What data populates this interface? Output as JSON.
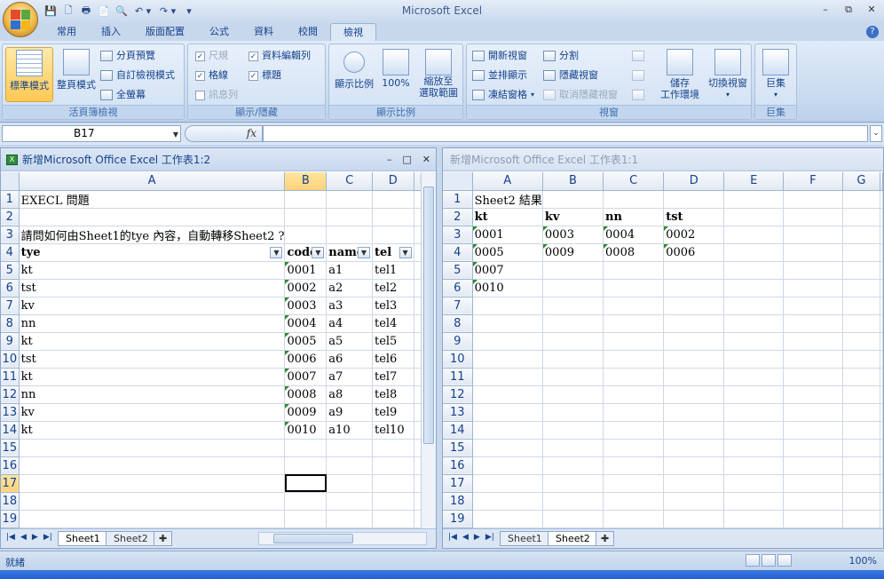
{
  "window": {
    "title": "Microsoft Excel",
    "controls": [
      "–",
      "⧉",
      "✕"
    ]
  },
  "qat": {
    "icons": [
      "💾",
      "🗋",
      "🖶",
      "📄",
      "🔍",
      "↶ ▾",
      "↷ ▾",
      "▾"
    ]
  },
  "tabs": [
    "常用",
    "插入",
    "版面配置",
    "公式",
    "資料",
    "校閱",
    "檢視"
  ],
  "active_tab": "檢視",
  "ribbon": {
    "workbook_views": {
      "label": "活頁簿檢視",
      "normal": "標準模式",
      "page_layout": "整頁模式",
      "page_break": "分頁預覽",
      "custom_views": "自訂檢視模式",
      "full_screen": "全螢幕"
    },
    "show_hide": {
      "label": "顯示/隱藏",
      "ruler": "尺規",
      "formula_bar": "資料編輯列",
      "gridlines": "格線",
      "headings": "標題",
      "message_bar": "訊息列"
    },
    "zoom": {
      "label": "顯示比例",
      "zoom": "顯示比例",
      "hundred": "100%",
      "zoom_to_sel_1": "縮放至",
      "zoom_to_sel_2": "選取範圍"
    },
    "window": {
      "label": "視窗",
      "new_window": "開新視窗",
      "arrange_all": "並排顯示",
      "freeze_panes": "凍結窗格",
      "split": "分割",
      "hide": "隱藏視窗",
      "unhide": "取消隱藏視窗",
      "save_workspace_1": "儲存",
      "save_workspace_2": "工作環境",
      "switch_windows": "切換視窗"
    },
    "macros": {
      "label": "巨集",
      "macros": "巨集"
    }
  },
  "formula_bar": {
    "name_box": "B17",
    "fx": "fx",
    "value": ""
  },
  "workbook1": {
    "title": "新增Microsoft Office Excel 工作表1:2",
    "columns": [
      "A",
      "B",
      "C",
      "D",
      "E"
    ],
    "selected_col": "B",
    "selected_row": "17",
    "rows": [
      {
        "n": "1",
        "cells": [
          "EXECL 問題",
          "",
          "",
          "",
          ""
        ]
      },
      {
        "n": "2",
        "cells": [
          "",
          "",
          "",
          "",
          ""
        ]
      },
      {
        "n": "3",
        "cells": [
          "請問如何由Sheet1的tye 內容，自動轉移Sheet2 ?",
          "",
          "",
          "",
          ""
        ]
      },
      {
        "n": "4",
        "cells": [
          "tye",
          "code",
          "name",
          "tel",
          ""
        ]
      },
      {
        "n": "5",
        "cells": [
          "kt",
          "0001",
          "a1",
          "tel1",
          ""
        ]
      },
      {
        "n": "6",
        "cells": [
          "tst",
          "0002",
          "a2",
          "tel2",
          ""
        ]
      },
      {
        "n": "7",
        "cells": [
          "kv",
          "0003",
          "a3",
          "tel3",
          ""
        ]
      },
      {
        "n": "8",
        "cells": [
          "nn",
          "0004",
          "a4",
          "tel4",
          ""
        ]
      },
      {
        "n": "9",
        "cells": [
          "kt",
          "0005",
          "a5",
          "tel5",
          ""
        ]
      },
      {
        "n": "10",
        "cells": [
          "tst",
          "0006",
          "a6",
          "tel6",
          ""
        ]
      },
      {
        "n": "11",
        "cells": [
          "kt",
          "0007",
          "a7",
          "tel7",
          ""
        ]
      },
      {
        "n": "12",
        "cells": [
          "nn",
          "0008",
          "a8",
          "tel8",
          ""
        ]
      },
      {
        "n": "13",
        "cells": [
          "kv",
          "0009",
          "a9",
          "tel9",
          ""
        ]
      },
      {
        "n": "14",
        "cells": [
          "kt",
          "0010",
          "a10",
          "tel10",
          ""
        ]
      },
      {
        "n": "15",
        "cells": [
          "",
          "",
          "",
          "",
          ""
        ]
      },
      {
        "n": "16",
        "cells": [
          "",
          "",
          "",
          "",
          ""
        ]
      },
      {
        "n": "17",
        "cells": [
          "",
          "",
          "",
          "",
          ""
        ]
      },
      {
        "n": "18",
        "cells": [
          "",
          "",
          "",
          "",
          ""
        ]
      },
      {
        "n": "19",
        "cells": [
          "",
          "",
          "",
          "",
          ""
        ]
      }
    ],
    "sheet_tabs": [
      "Sheet1",
      "Sheet2"
    ],
    "active_sheet": "Sheet1"
  },
  "workbook2": {
    "title": "新增Microsoft Office Excel 工作表1:1",
    "columns": [
      "A",
      "B",
      "C",
      "D",
      "E",
      "F",
      "G"
    ],
    "rows": [
      {
        "n": "1",
        "cells": [
          "Sheet2 結果",
          "",
          "",
          "",
          "",
          "",
          ""
        ]
      },
      {
        "n": "2",
        "cells": [
          "kt",
          "kv",
          "nn",
          "tst",
          "",
          "",
          ""
        ]
      },
      {
        "n": "3",
        "cells": [
          "0001",
          "0003",
          "0004",
          "0002",
          "",
          "",
          ""
        ]
      },
      {
        "n": "4",
        "cells": [
          "0005",
          "0009",
          "0008",
          "0006",
          "",
          "",
          ""
        ]
      },
      {
        "n": "5",
        "cells": [
          "0007",
          "",
          "",
          "",
          "",
          "",
          ""
        ]
      },
      {
        "n": "6",
        "cells": [
          "0010",
          "",
          "",
          "",
          "",
          "",
          ""
        ]
      },
      {
        "n": "7",
        "cells": [
          "",
          "",
          "",
          "",
          "",
          "",
          ""
        ]
      },
      {
        "n": "8",
        "cells": [
          "",
          "",
          "",
          "",
          "",
          "",
          ""
        ]
      },
      {
        "n": "9",
        "cells": [
          "",
          "",
          "",
          "",
          "",
          "",
          ""
        ]
      },
      {
        "n": "10",
        "cells": [
          "",
          "",
          "",
          "",
          "",
          "",
          ""
        ]
      },
      {
        "n": "11",
        "cells": [
          "",
          "",
          "",
          "",
          "",
          "",
          ""
        ]
      },
      {
        "n": "12",
        "cells": [
          "",
          "",
          "",
          "",
          "",
          "",
          ""
        ]
      },
      {
        "n": "13",
        "cells": [
          "",
          "",
          "",
          "",
          "",
          "",
          ""
        ]
      },
      {
        "n": "14",
        "cells": [
          "",
          "",
          "",
          "",
          "",
          "",
          ""
        ]
      },
      {
        "n": "15",
        "cells": [
          "",
          "",
          "",
          "",
          "",
          "",
          ""
        ]
      },
      {
        "n": "16",
        "cells": [
          "",
          "",
          "",
          "",
          "",
          "",
          ""
        ]
      },
      {
        "n": "17",
        "cells": [
          "",
          "",
          "",
          "",
          "",
          "",
          ""
        ]
      },
      {
        "n": "18",
        "cells": [
          "",
          "",
          "",
          "",
          "",
          "",
          ""
        ]
      },
      {
        "n": "19",
        "cells": [
          "",
          "",
          "",
          "",
          "",
          "",
          ""
        ]
      }
    ],
    "sheet_tabs": [
      "Sheet1",
      "Sheet2"
    ],
    "active_sheet": "Sheet2"
  },
  "status": {
    "text": "就緒",
    "zoom": "100%"
  }
}
